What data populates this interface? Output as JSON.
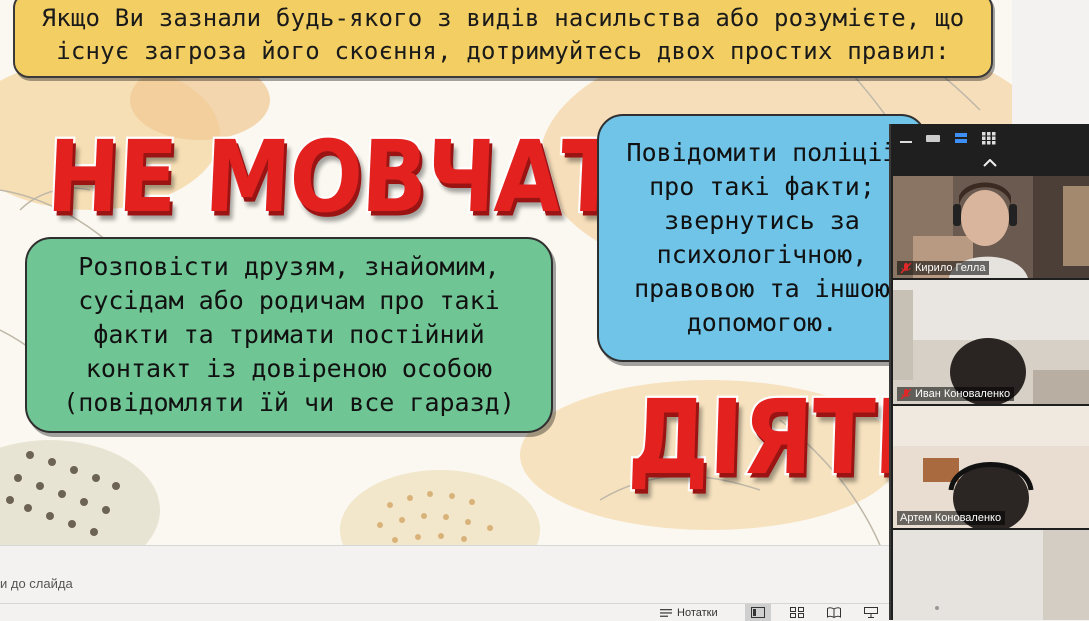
{
  "slide": {
    "title": "Якщо Ви зазнали будь-якого з видів насильства або розумієте, що\nіснує загроза його скоєння, дотримуйтесь двох простих правил:",
    "rule1_heading": "НЕ МОВЧАТИ",
    "rule1_text": "Розповісти друзям, знайомим,\nсусідам або родичам про такі\nфакти та тримати постійний\nконтакт із довіреною особою\n(повідомляти їй чи все гаразд)",
    "rule2_heading": "ДІЯТИ",
    "rule2_text": "Повідомити поліції\nпро такі факти;\nзвернутись за\nпсихологічною,\nправовою та іншою\nдопомогою."
  },
  "notes": {
    "placeholder": "и до слайда"
  },
  "status_bar": {
    "notes_label": "Нотатки"
  },
  "zoom": {
    "participants": [
      {
        "name": "Кирило Гелла",
        "muted": true
      },
      {
        "name": "Иван Коноваленко",
        "muted": true
      },
      {
        "name": "Артем Коноваленко",
        "muted": false
      },
      {
        "name": "",
        "muted": false
      }
    ]
  },
  "colors": {
    "title_box": "#f3cf63",
    "heading_red": "#e3221f",
    "card_green": "#6fc594",
    "card_blue": "#6fc4e8",
    "mic_off_red": "#e02828"
  }
}
